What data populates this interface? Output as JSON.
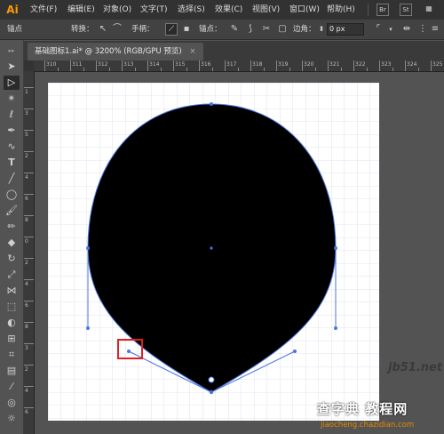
{
  "app": {
    "logo": "Ai",
    "logo_color": "#ff9a00",
    "accent_color": "#4c75e0",
    "highlight_color": "#e02020"
  },
  "menubar": {
    "items": [
      {
        "label": "文件(F)"
      },
      {
        "label": "编辑(E)"
      },
      {
        "label": "对象(O)"
      },
      {
        "label": "文字(T)"
      },
      {
        "label": "选择(S)"
      },
      {
        "label": "效果(C)"
      },
      {
        "label": "视图(V)"
      },
      {
        "label": "窗口(W)"
      },
      {
        "label": "帮助(H)"
      }
    ],
    "right_icons": [
      "bridge-icon",
      "stock-icon"
    ],
    "bridge_label": "Br",
    "stock_label": "St"
  },
  "control_bar": {
    "anchor_label": "锚点",
    "convert_label": "转换：",
    "handles_label": "手柄：",
    "anchors_label": "锚点：",
    "corner_label": "边角：",
    "corner_value": "0 px"
  },
  "document_tab": {
    "title": "基础图标1.ai* @ 3200% (RGB/GPU 预览)",
    "close": "×"
  },
  "ruler": {
    "h_labels": [
      "310",
      "311",
      "312",
      "313",
      "314",
      "315",
      "316",
      "317",
      "318",
      "319",
      "320",
      "321",
      "322",
      "323",
      "324",
      "325"
    ],
    "v_labels": [
      "1",
      "3",
      "5",
      "2",
      "4",
      "6",
      "8",
      "0",
      "2",
      "4",
      "6",
      "8",
      "3",
      "2",
      "4",
      "6",
      "7"
    ]
  },
  "tools": [
    "selection-tool",
    "direct-selection-tool",
    "magic-wand-tool",
    "lasso-tool",
    "pen-tool",
    "curvature-tool",
    "type-tool",
    "line-tool",
    "ellipse-tool",
    "paintbrush-tool",
    "pencil-tool",
    "shaper-tool",
    "eraser-tool",
    "rotate-tool",
    "scale-tool",
    "width-tool",
    "free-transform-tool",
    "shape-builder-tool",
    "perspective-grid-tool",
    "mesh-tool",
    "gradient-tool",
    "eyedropper-tool",
    "blend-tool",
    "symbol-sprayer-tool",
    "column-graph-tool"
  ],
  "watermark": {
    "site": "jb51.net",
    "brand": "查字典 教程网",
    "url": "jiaocheng.chazidian.com"
  }
}
